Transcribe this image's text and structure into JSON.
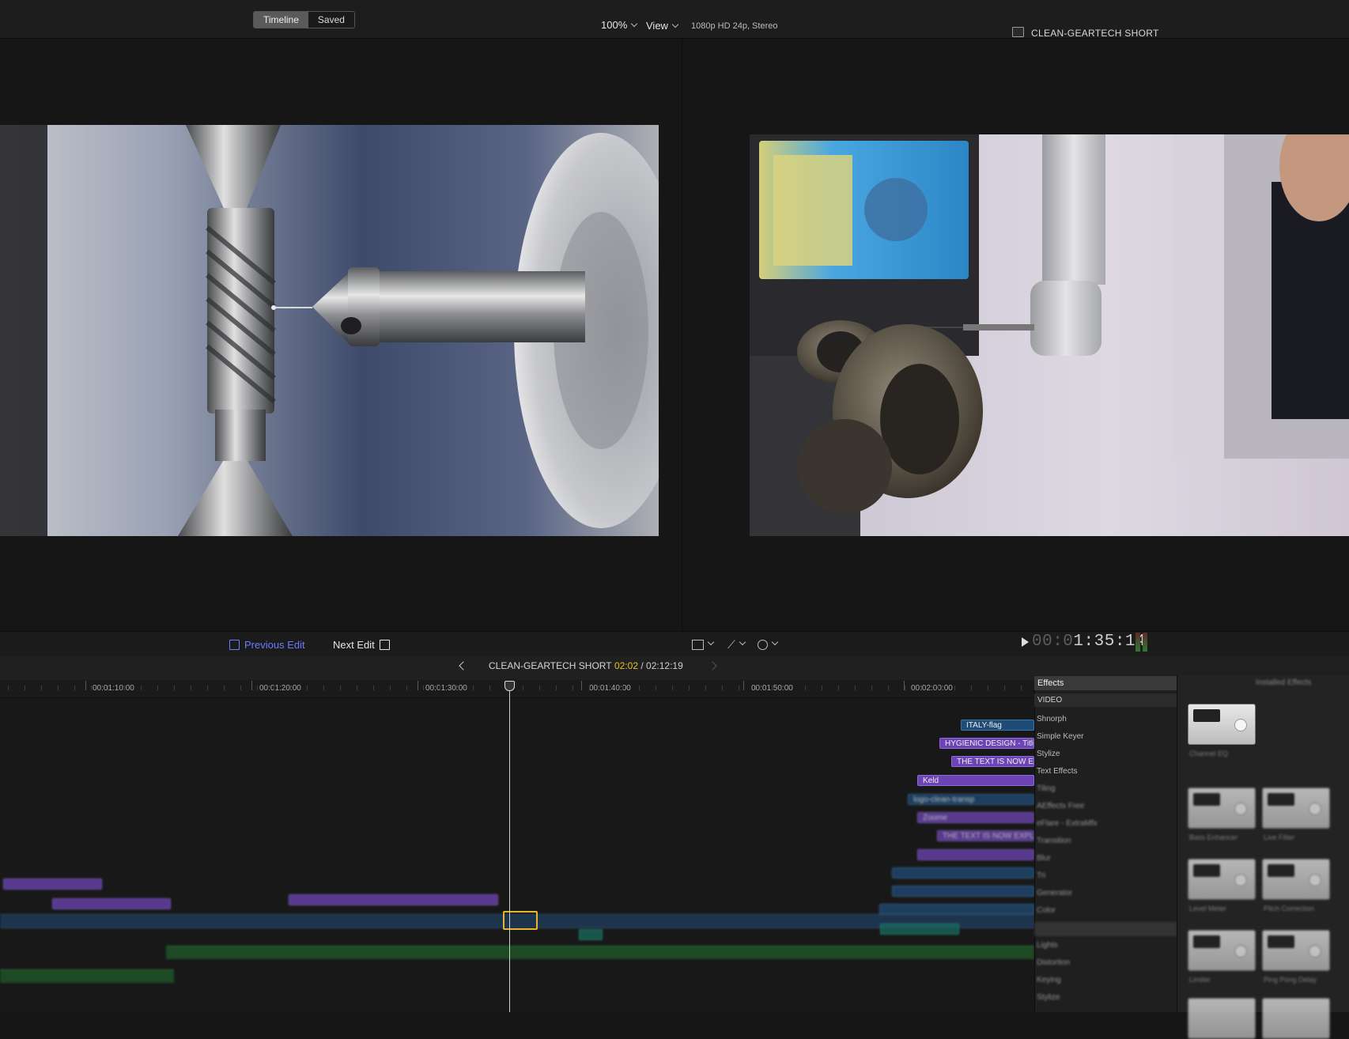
{
  "toolbar": {
    "segment": [
      "Timeline",
      "Saved"
    ],
    "zoom": "100%",
    "view_menu": "View",
    "format": "1080p HD 24p, Stereo",
    "viewer_title": "CLEAN-GEARTECH SHORT"
  },
  "viewer_toolbar": {
    "previous_edit": "Previous Edit",
    "next_edit": "Next Edit",
    "timecode_dim": "00:0",
    "timecode": "1:35:14"
  },
  "timeline": {
    "project_name": "CLEAN-GEARTECH SHORT",
    "position": "02:02",
    "duration": "/ 02:12:19",
    "ruler": [
      "00:01:10:00",
      "00:01:20:00",
      "00:01:30:00",
      "00:01:40:00",
      "00:01:50:00",
      "00:02:00:00"
    ],
    "clips": [
      "ITALY-flag",
      "HYGIENIC DESIGN - Title...",
      "THE TEXT IS NOW E...",
      "Keld",
      "logo-clean-transp",
      "Zoome",
      "THE TEXT IS NOW EXPL..."
    ]
  },
  "effects": {
    "title": "Effects",
    "header": "Installed Effects",
    "category": "VIDEO",
    "items": [
      "Shnorph",
      "Simple Keyer",
      "Stylize",
      "Text Effects",
      "Tiling",
      "AEffects Free",
      "eFlare - ExtraMfx",
      "Transition",
      "Blur",
      "Tri",
      "Generator",
      "Color",
      "Lights",
      "Distortion",
      "Keying",
      "Stylize"
    ],
    "thumb_captions": [
      "Channel EQ",
      "Bass Enhancer",
      "Live Filter",
      "Level Meter",
      "Pitch Correction",
      "Limiter",
      "Ping Pong Delay"
    ]
  },
  "colors": {
    "accent_blue": "#6a7cff",
    "timecode_yellow": "#e6c22a",
    "clip_purple": "#6c44b6",
    "clip_blue": "#1f4b77",
    "audio_green": "#1f5b2a"
  }
}
